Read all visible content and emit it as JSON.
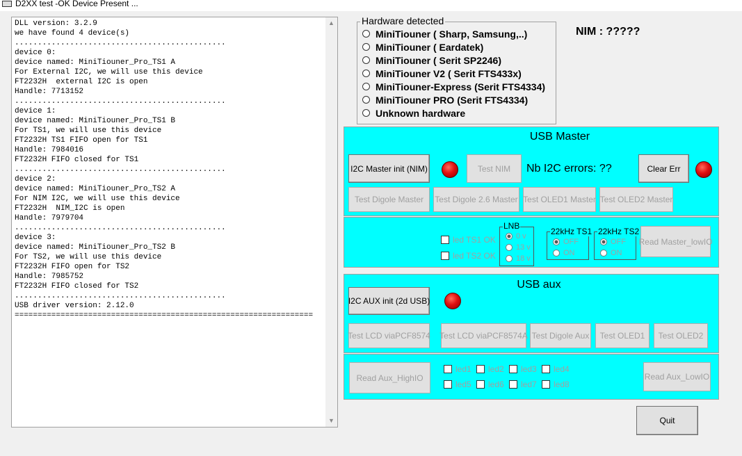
{
  "window": {
    "title": "D2XX test -OK Device Present ..."
  },
  "log_lines": [
    "DLL version: 3.2.9",
    "we have found 4 device(s)",
    "..............................................",
    "device 0:",
    "device named: MiniTiouner_Pro_TS1 A",
    "For External I2C, we will use this device",
    "FT2232H  external I2C is open",
    "Handle: 7713152",
    "..............................................",
    "device 1:",
    "device named: MiniTiouner_Pro_TS1 B",
    "For TS1, we will use this device",
    "FT2232H TS1 FIFO open for TS1",
    "Handle: 7984016",
    "FT2232H FIFO closed for TS1",
    "..............................................",
    "device 2:",
    "device named: MiniTiouner_Pro_TS2 A",
    "For NIM I2C, we will use this device",
    "FT2232H  NIM_I2C is open",
    "Handle: 7979704",
    "..............................................",
    "device 3:",
    "device named: MiniTiouner_Pro_TS2 B",
    "For TS2, we will use this device",
    "FT2232H FIFO open for TS2",
    "Handle: 7985752",
    "FT2232H FIFO closed for TS2",
    "..............................................",
    "USB driver version: 2.12.0",
    "================================================================="
  ],
  "hardware": {
    "title": "Hardware detected",
    "options": [
      "MiniTiouner ( Sharp, Samsung,..)",
      "MiniTiouner ( Eardatek)",
      "MiniTiouner ( Serit SP2246)",
      "MiniTiouner V2 ( Serit FTS433x)",
      "MiniTiouner-Express (Serit FTS4334)",
      "MiniTiouner PRO  (Serit FTS4334)",
      "Unknown hardware"
    ]
  },
  "nim_status": "NIM : ?????",
  "usb_master": {
    "title": "USB Master",
    "i2c_init": "I2C Master init (NIM)",
    "test_nim": "Test NIM",
    "i2c_errors": "Nb I2C errors:  ??",
    "clear_err": "Clear Err",
    "test_buttons": [
      "Test Digole Master",
      "Test Digole 2.6 Master",
      "Test OLED1 Master",
      "Test OLED2 Master"
    ],
    "led_ts1": "led TS1 OK",
    "led_ts2": "led TS2 OK",
    "lnb": {
      "title": "LNB",
      "options": [
        "0 v",
        "13 v",
        "18 v"
      ],
      "selected": "0 v"
    },
    "khz_ts1": {
      "title": "22kHz TS1",
      "options": [
        "OFF",
        "ON"
      ],
      "selected": "OFF"
    },
    "khz_ts2": {
      "title": "22kHz TS2",
      "options": [
        "OFF",
        "ON"
      ],
      "selected": "OFF"
    },
    "read_lowio": "Read Master_lowIO"
  },
  "usb_aux": {
    "title": "USB aux",
    "i2c_init": "I2C AUX init (2d USB)",
    "test_buttons": [
      "Test LCD viaPCF8574",
      "Test LCD viaPCF8574A",
      "Test Digole Aux",
      "Test OLED1",
      "Test OLED2"
    ],
    "read_highio": "Read Aux_HighIO",
    "leds": [
      "led1",
      "led2",
      "led3",
      "led4",
      "led5",
      "led6",
      "led7",
      "led8"
    ],
    "read_lowio": "Read Aux_LowIO"
  },
  "quit": "Quit",
  "colors": {
    "panel": "#00ffff",
    "led": "#e01010",
    "window": "#f0f0f0"
  }
}
